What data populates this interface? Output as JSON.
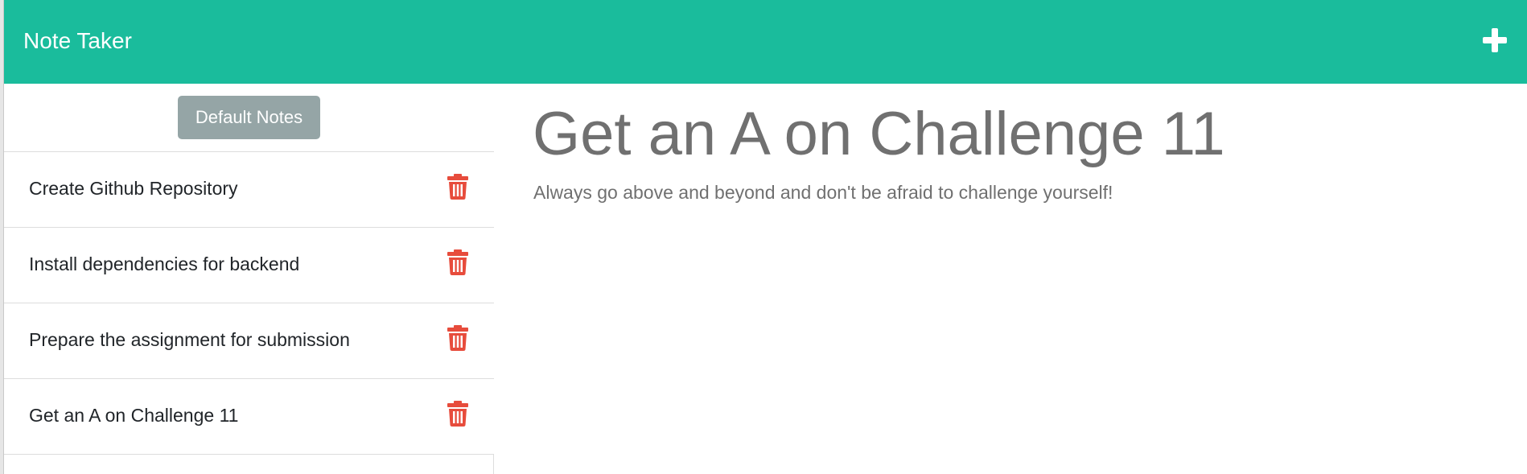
{
  "header": {
    "title": "Note Taker",
    "add_icon": "plus-icon",
    "background": "#1abc9c"
  },
  "sidebar": {
    "default_button_label": "Default Notes",
    "default_button_color": "#95a5a6",
    "notes": [
      {
        "title": "Create Github Repository",
        "delete_icon": "trash-icon"
      },
      {
        "title": "Install dependencies for backend",
        "delete_icon": "trash-icon"
      },
      {
        "title": "Prepare the assignment for submission",
        "delete_icon": "trash-icon"
      },
      {
        "title": "Get an A on Challenge 11",
        "delete_icon": "trash-icon"
      }
    ],
    "trash_color": "#e74c3c"
  },
  "main": {
    "note_title": "Get an A on Challenge 11",
    "note_text": "Always go above and beyond and don't be afraid to challenge yourself!"
  }
}
